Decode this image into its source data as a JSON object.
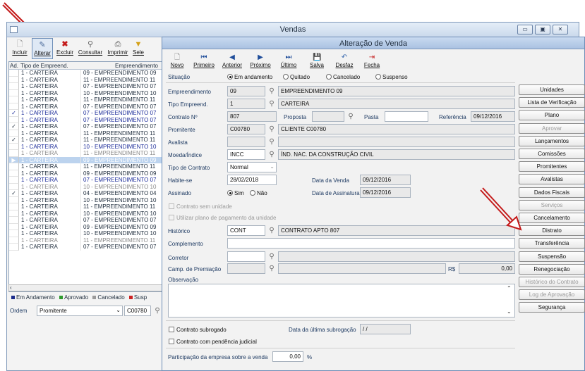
{
  "vendas": {
    "title": "Vendas",
    "toolbar": [
      {
        "label": "Incluir",
        "icon": "new-doc-icon"
      },
      {
        "label": "Alterar",
        "icon": "edit-doc-icon"
      },
      {
        "label": "Excluir",
        "icon": "delete-icon"
      },
      {
        "label": "Consultar",
        "icon": "search-icon"
      },
      {
        "label": "Imprimir",
        "icon": "print-icon"
      },
      {
        "label": "Sele",
        "icon": "filter-icon"
      }
    ],
    "grid": {
      "headers": [
        "Ad.",
        "Tipo de Empreend.",
        "Empreendimento"
      ],
      "rows": [
        {
          "check": "",
          "tipo": "1 - CARTEIRA",
          "emp": "09 - EMPREENDIMENTO 09",
          "status": "normal"
        },
        {
          "check": "",
          "tipo": "1 - CARTEIRA",
          "emp": "11 - EMPREENDIMENTO 11",
          "status": "normal"
        },
        {
          "check": "",
          "tipo": "1 - CARTEIRA",
          "emp": "07 - EMPREENDIMENTO 07",
          "status": "normal"
        },
        {
          "check": "",
          "tipo": "1 - CARTEIRA",
          "emp": "10 - EMPREENDIMENTO 10",
          "status": "normal"
        },
        {
          "check": "",
          "tipo": "1 - CARTEIRA",
          "emp": "11 - EMPREENDIMENTO 11",
          "status": "normal"
        },
        {
          "check": "",
          "tipo": "1 - CARTEIRA",
          "emp": "07 - EMPREENDIMENTO 07",
          "status": "normal"
        },
        {
          "check": "✓",
          "tipo": "1 - CARTEIRA",
          "emp": "07 - EMPREENDIMENTO 07",
          "status": "prop"
        },
        {
          "check": "",
          "tipo": "1 - CARTEIRA",
          "emp": "07 - EMPREENDIMENTO 07",
          "status": "prop"
        },
        {
          "check": "✓",
          "tipo": "1 - CARTEIRA",
          "emp": "07 - EMPREENDIMENTO 07",
          "status": "normal"
        },
        {
          "check": "",
          "tipo": "1 - CARTEIRA",
          "emp": "11 - EMPREENDIMENTO 11",
          "status": "normal"
        },
        {
          "check": "✓",
          "tipo": "1 - CARTEIRA",
          "emp": "11 - EMPREENDIMENTO 11",
          "status": "normal"
        },
        {
          "check": "",
          "tipo": "1 - CARTEIRA",
          "emp": "10 - EMPREENDIMENTO 10",
          "status": "prop"
        },
        {
          "check": "",
          "tipo": "1 - CARTEIRA",
          "emp": "11 - EMPREENDIMENTO 11",
          "status": "canc"
        },
        {
          "check": "▶",
          "tipo": "1 - CARTEIRA",
          "emp": "09 - EMPREENDIMENTO 09",
          "status": "sel"
        },
        {
          "check": "",
          "tipo": "1 - CARTEIRA",
          "emp": "11 - EMPREENDIMENTO 11",
          "status": "normal"
        },
        {
          "check": "",
          "tipo": "1 - CARTEIRA",
          "emp": "09 - EMPREENDIMENTO 09",
          "status": "normal"
        },
        {
          "check": "",
          "tipo": "1 - CARTEIRA",
          "emp": "07 - EMPREENDIMENTO 07",
          "status": "prop"
        },
        {
          "check": "",
          "tipo": "1 - CARTEIRA",
          "emp": "10 - EMPREENDIMENTO 10",
          "status": "canc"
        },
        {
          "check": "✓",
          "tipo": "1 - CARTEIRA",
          "emp": "04 - EMPREENDIMENTO 04",
          "status": "normal"
        },
        {
          "check": "",
          "tipo": "1 - CARTEIRA",
          "emp": "10 - EMPREENDIMENTO 10",
          "status": "normal"
        },
        {
          "check": "",
          "tipo": "1 - CARTEIRA",
          "emp": "11 - EMPREENDIMENTO 11",
          "status": "normal"
        },
        {
          "check": "",
          "tipo": "1 - CARTEIRA",
          "emp": "10 - EMPREENDIMENTO 10",
          "status": "normal"
        },
        {
          "check": "",
          "tipo": "1 - CARTEIRA",
          "emp": "07 - EMPREENDIMENTO 07",
          "status": "normal"
        },
        {
          "check": "",
          "tipo": "1 - CARTEIRA",
          "emp": "09 - EMPREENDIMENTO 09",
          "status": "normal"
        },
        {
          "check": "",
          "tipo": "1 - CARTEIRA",
          "emp": "10 - EMPREENDIMENTO 10",
          "status": "normal"
        },
        {
          "check": "",
          "tipo": "1 - CARTEIRA",
          "emp": "11 - EMPREENDIMENTO 11",
          "status": "canc"
        },
        {
          "check": "",
          "tipo": "1 - CARTEIRA",
          "emp": "07 - EMPREENDIMENTO 07",
          "status": "normal"
        }
      ]
    },
    "legend": [
      {
        "label": "Em Andamento",
        "color": "#1a2a8a"
      },
      {
        "label": "Aprovado",
        "color": "#2e9a2e"
      },
      {
        "label": "Cancelado",
        "color": "#9a9a9a"
      },
      {
        "label": "Susp",
        "color": "#cc2222"
      }
    ],
    "ordem": {
      "label": "Ordem",
      "value": "Promitente",
      "search_value": "C00780"
    }
  },
  "alteracao": {
    "title": "Alteração de Venda",
    "toolbar": [
      {
        "label": "Novo",
        "icon": "new-icon"
      },
      {
        "label": "Primeiro",
        "icon": "first-icon"
      },
      {
        "label": "Anterior",
        "icon": "prev-icon"
      },
      {
        "label": "Próximo",
        "icon": "next-icon"
      },
      {
        "label": "Último",
        "icon": "last-icon"
      },
      {
        "label": "Salva",
        "icon": "save-icon"
      },
      {
        "label": "Desfaz",
        "icon": "undo-icon"
      },
      {
        "label": "Fecha",
        "icon": "close-icon"
      }
    ],
    "situacao": {
      "label": "Situação",
      "options": [
        "Em andamento",
        "Quitado",
        "Cancelado",
        "Suspenso"
      ],
      "selected": "Em andamento"
    },
    "fields": {
      "empreendimento": {
        "label": "Empreendimento",
        "code": "09",
        "desc": "EMPREENDIMENTO 09"
      },
      "tipo_empreend": {
        "label": "Tipo Empreend.",
        "code": "1",
        "desc": "CARTEIRA"
      },
      "contrato": {
        "label": "Contrato Nº",
        "value": "807"
      },
      "proposta": {
        "label": "Proposta",
        "value": ""
      },
      "pasta": {
        "label": "Pasta",
        "value": ""
      },
      "referencia": {
        "label": "Referência",
        "value": "09/12/2016"
      },
      "promitente": {
        "label": "Promitente",
        "code": "C00780",
        "desc": "CLIENTE C00780"
      },
      "avalista": {
        "label": "Avalista",
        "code": "",
        "desc": ""
      },
      "moeda": {
        "label": "Moeda/Índice",
        "code": "INCC",
        "desc": "ÍND. NAC. DA CONSTRUÇÃO CIVIL"
      },
      "tipo_contrato": {
        "label": "Tipo de Contrato",
        "value": "Normal"
      },
      "habite_se": {
        "label": "Habite-se",
        "value": "28/02/2018"
      },
      "data_venda": {
        "label": "Data da Venda",
        "value": "09/12/2016"
      },
      "assinado": {
        "label": "Assinado",
        "yes": "Sim",
        "no": "Não",
        "selected": "Sim"
      },
      "data_assinatura": {
        "label": "Data de Assinatura",
        "value": "09/12/2016"
      },
      "contrato_sem_unidade": "Contrato sem unidade",
      "utilizar_plano": "Utilizar plano de pagamento da unidade",
      "historico": {
        "label": "Histórico",
        "code": "CONT",
        "desc": "CONTRATO APTO 807"
      },
      "complemento": {
        "label": "Complemento",
        "value": ""
      },
      "corretor": {
        "label": "Corretor",
        "code": "",
        "desc": ""
      },
      "camp_premiacao": {
        "label": "Camp. de Premiação",
        "currency": "R$",
        "value": "0,00"
      },
      "observacao": {
        "label": "Observação",
        "value": ""
      },
      "contrato_subrogado": "Contrato subrogado",
      "data_ultima_subrogacao": {
        "label": "Data da última subrogação",
        "value": "/ /"
      },
      "pendencia_judicial": "Contrato com pendência judicial",
      "participacao": {
        "label": "Participação da empresa sobre a venda",
        "value": "0,00",
        "unit": "%"
      }
    },
    "side_buttons": [
      {
        "label": "Unidades",
        "enabled": true
      },
      {
        "label": "Lista de Verificação",
        "enabled": true
      },
      {
        "label": "Plano",
        "enabled": true
      },
      {
        "label": "Aprovar",
        "enabled": false
      },
      {
        "label": "Lançamentos",
        "enabled": true
      },
      {
        "label": "Comissões",
        "enabled": true
      },
      {
        "label": "Promitentes",
        "enabled": true
      },
      {
        "label": "Avalistas",
        "enabled": true
      },
      {
        "label": "Dados Fiscais",
        "enabled": true
      },
      {
        "label": "Serviços",
        "enabled": false
      },
      {
        "label": "Cancelamento",
        "enabled": true
      },
      {
        "label": "Distrato",
        "enabled": true
      },
      {
        "label": "Transferência",
        "enabled": true
      },
      {
        "label": "Suspensão",
        "enabled": true
      },
      {
        "label": "Renegociação",
        "enabled": true
      },
      {
        "label": "Histórico do Contrato",
        "enabled": false
      },
      {
        "label": "Log de Aprovação",
        "enabled": false
      },
      {
        "label": "Segurança",
        "enabled": true
      }
    ],
    "accent_color": "#c41a1a"
  }
}
